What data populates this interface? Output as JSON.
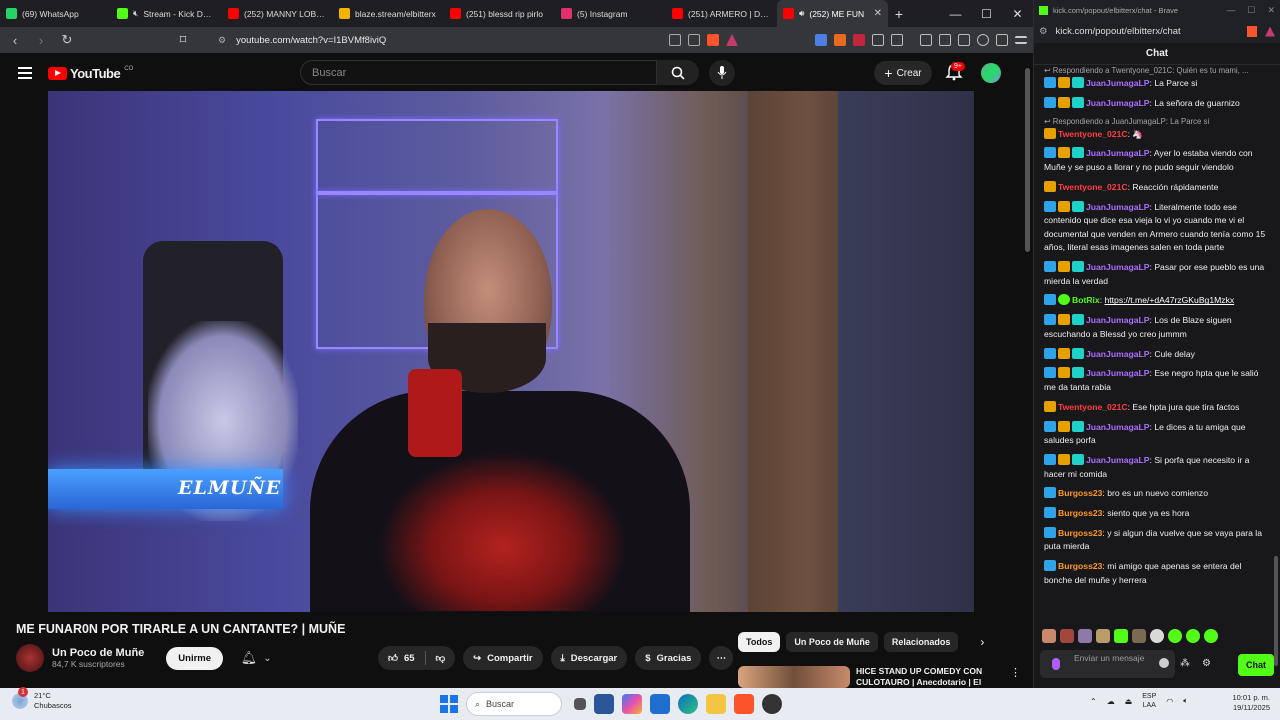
{
  "tabs": [
    {
      "title": "(69) WhatsApp",
      "favicon_color": "#25d366",
      "icon": "whatsapp-icon"
    },
    {
      "title": "Stream - Kick Dash",
      "favicon_color": "#53fc18",
      "icon": "kick-icon",
      "muted": true
    },
    {
      "title": "(252) MANNY LOBO -",
      "favicon_color": "#ff0000",
      "icon": "youtube-icon"
    },
    {
      "title": "blaze.stream/elbitterx",
      "favicon_color": "#f4b400",
      "icon": "blaze-icon"
    },
    {
      "title": "(251) blessd rip pirlo",
      "favicon_color": "#ff0000",
      "icon": "youtube-icon"
    },
    {
      "title": "(5) Instagram",
      "favicon_color": "#e1306c",
      "icon": "instagram-icon"
    },
    {
      "title": "(251) ARMERO | DOC",
      "favicon_color": "#ff0000",
      "icon": "youtube-icon"
    },
    {
      "title": "(252) ME FUN",
      "favicon_color": "#ff0000",
      "icon": "youtube-icon",
      "active": true
    }
  ],
  "address": {
    "url": "youtube.com/watch?v=I1BVMf8iviQ"
  },
  "youtube": {
    "logo_text": "YouTube",
    "country": "CO",
    "search_placeholder": "Buscar",
    "create_label": "Crear",
    "notif_count": "9+"
  },
  "video": {
    "watermark": "ELMUÑE",
    "title": "ME FUNAR0N POR TIRARLE A UN CANTANTE? | MUÑE",
    "channel": "Un Poco de Muñe",
    "subscribers": "84,7 K suscriptores",
    "join_label": "Unirme",
    "likes": "65",
    "share_label": "Compartir",
    "download_label": "Descargar",
    "thanks_label": "Gracias"
  },
  "chips": [
    {
      "label": "Todos",
      "active": true
    },
    {
      "label": "Un Poco de Muñe"
    },
    {
      "label": "Relacionados"
    }
  ],
  "recommended": {
    "title": "HICE STAND UP COMEDY CON CULOTAURO | Anecdotario | El"
  },
  "chat_window": {
    "title_url": "kick.com/popout/elbitterx/chat - Brave",
    "url": "kick.com/popout/elbitterx/chat",
    "header": "Chat",
    "input_placeholder": "Enviar un mensaje",
    "send_label": "Chat"
  },
  "chat": [
    {
      "reply": "Respondiendo a Twentyone_021C: Quién es tu mami, ..."
    },
    {
      "badges": [
        "b1",
        "b2",
        "b3"
      ],
      "user": "JuanJumagaLP",
      "color": "purple",
      "text": "La Parce si"
    },
    {
      "badges": [
        "b1",
        "b2",
        "b3"
      ],
      "user": "JuanJumagaLP",
      "color": "purple",
      "text": "La señora de guarnizo"
    },
    {
      "reply": "Respondiendo a JuanJumagaLP: La Parce si"
    },
    {
      "badges": [
        "b2"
      ],
      "user": "Twentyone_021C",
      "color": "red",
      "text": "🦄"
    },
    {
      "badges": [
        "b1",
        "b2",
        "b3"
      ],
      "user": "JuanJumagaLP",
      "color": "purple",
      "text": "Ayer lo estaba viendo con Muñe y se puso a llorar y no pudo seguir viendolo"
    },
    {
      "badges": [
        "b2"
      ],
      "user": "Twentyone_021C",
      "color": "red",
      "text": "Reacción rápidamente"
    },
    {
      "badges": [
        "b1",
        "b2",
        "b3"
      ],
      "user": "JuanJumagaLP",
      "color": "purple",
      "text": "Literalmente todo ese contenido que dice esa vieja lo vi yo cuando me vi el documental que venden en Armero cuando tenía como 15 años, literal esas imagenes salen en toda parte"
    },
    {
      "badges": [
        "b1",
        "b2",
        "b3"
      ],
      "user": "JuanJumagaLP",
      "color": "purple",
      "text": "Pasar por ese pueblo es una mierda la verdad"
    },
    {
      "badges": [
        "b1",
        "b4"
      ],
      "user": "BotRix",
      "color": "green",
      "text": "",
      "link": "https://t.me/+dA47rzGKuBg1Mzkx"
    },
    {
      "badges": [
        "b1",
        "b2",
        "b3"
      ],
      "user": "JuanJumagaLP",
      "color": "purple",
      "text": "Los de Blaze siguen escuchando a Blessd yo creo jummm"
    },
    {
      "badges": [
        "b1",
        "b2",
        "b3"
      ],
      "user": "JuanJumagaLP",
      "color": "purple",
      "text": "Cule delay"
    },
    {
      "badges": [
        "b1",
        "b2",
        "b3"
      ],
      "user": "JuanJumagaLP",
      "color": "purple",
      "text": "Ese negro hpta que le salió me da tanta rabia"
    },
    {
      "badges": [
        "b2"
      ],
      "user": "Twentyone_021C",
      "color": "red",
      "text": "Ese hpta jura que tira factos"
    },
    {
      "badges": [
        "b1",
        "b2",
        "b3"
      ],
      "user": "JuanJumagaLP",
      "color": "purple",
      "text": "Le dices a tu amiga que saludes porfa"
    },
    {
      "badges": [
        "b1",
        "b2",
        "b3"
      ],
      "user": "JuanJumagaLP",
      "color": "purple",
      "text": "Si porfa que necesito ir a hacer mi comida"
    },
    {
      "badges": [
        "b1"
      ],
      "user": "Burgoss23",
      "color": "orange",
      "text": "bro es un nuevo comienzo"
    },
    {
      "badges": [
        "b1"
      ],
      "user": "Burgoss23",
      "color": "orange",
      "text": "siento que ya es hora"
    },
    {
      "badges": [
        "b1"
      ],
      "user": "Burgoss23",
      "color": "orange",
      "text": "y si algun dia vuelve que se vaya para la puta mierda"
    },
    {
      "badges": [
        "b1"
      ],
      "user": "Burgoss23",
      "color": "orange",
      "text": "mi amigo que apenas se entera del bonche del muñe y herrera"
    }
  ],
  "taskbar": {
    "weather_temp": "21°C",
    "weather_desc": "Chubascos",
    "weather_notif": "1",
    "search_label": "Buscar",
    "lang1": "ESP",
    "lang2": "LAA",
    "time": "10:01 p. m.",
    "date": "19/11/2025"
  }
}
